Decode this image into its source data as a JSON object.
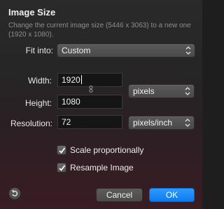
{
  "dialog": {
    "title": "Image Size",
    "description": "Change the current image size (5446 x 3063) to a new one (1920 x 1080)."
  },
  "fit_into": {
    "label": "Fit into:",
    "value": "Custom"
  },
  "width": {
    "label": "Width:",
    "value": "1920"
  },
  "height": {
    "label": "Height:",
    "value": "1080"
  },
  "size_unit": {
    "value": "pixels"
  },
  "resolution": {
    "label": "Resolution:",
    "value": "72",
    "unit": "pixels/inch"
  },
  "options": {
    "scale_proportionally": {
      "label": "Scale proportionally",
      "checked": true
    },
    "resample_image": {
      "label": "Resample Image",
      "checked": true
    }
  },
  "buttons": {
    "cancel": "Cancel",
    "ok": "OK",
    "revert_icon": "revert-arrow-icon"
  },
  "colors": {
    "accent": "#0a7cf0",
    "panel": "#262626"
  }
}
